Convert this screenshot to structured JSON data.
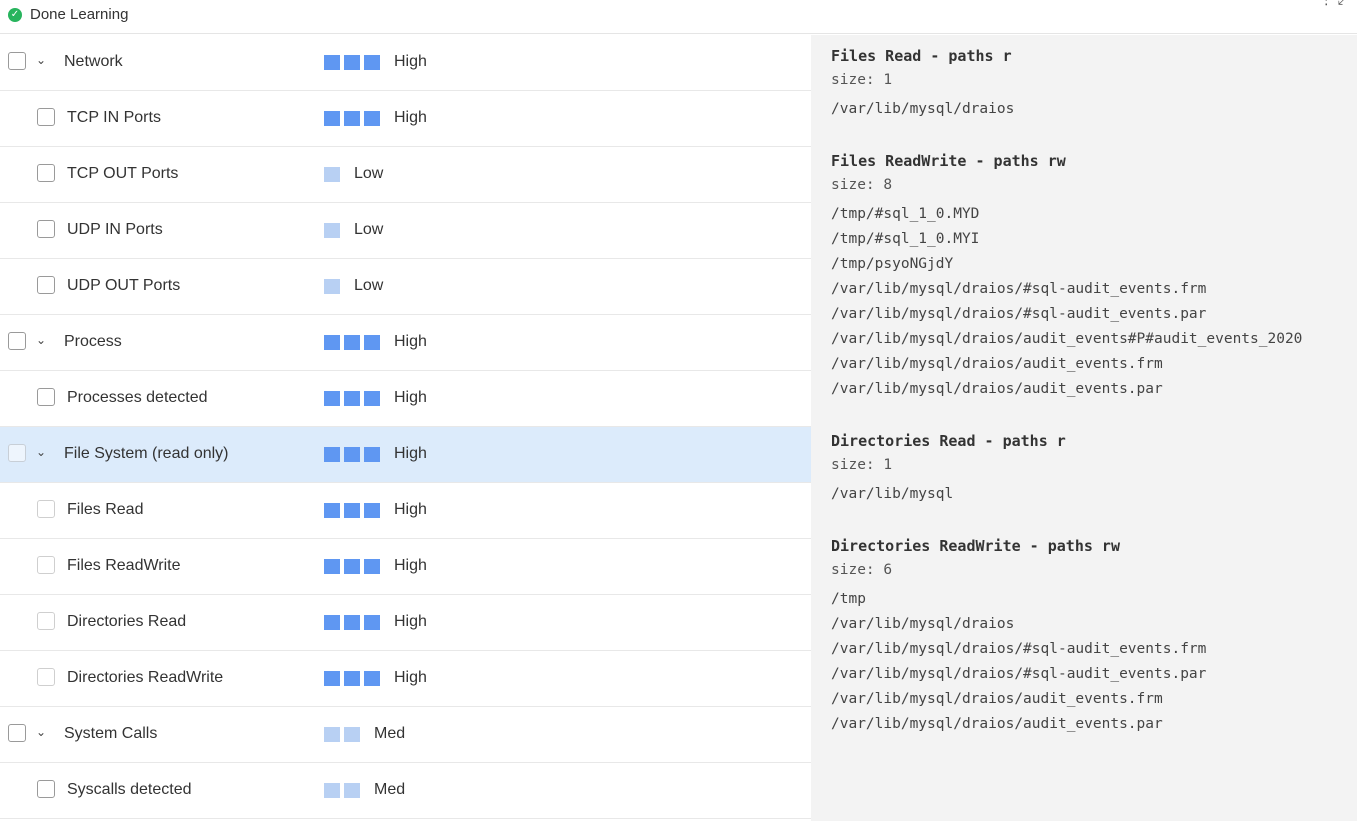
{
  "status": {
    "text": "Done Learning",
    "color": "#27b45d"
  },
  "rows": [
    {
      "label": "Network",
      "level": "High",
      "bars": 3,
      "kind": "parent",
      "selected": false
    },
    {
      "label": "TCP IN Ports",
      "level": "High",
      "bars": 3,
      "kind": "child",
      "selected": false
    },
    {
      "label": "TCP OUT Ports",
      "level": "Low",
      "bars": 1,
      "kind": "child",
      "selected": false
    },
    {
      "label": "UDP IN Ports",
      "level": "Low",
      "bars": 1,
      "kind": "child",
      "selected": false
    },
    {
      "label": "UDP OUT Ports",
      "level": "Low",
      "bars": 1,
      "kind": "child",
      "selected": false
    },
    {
      "label": "Process",
      "level": "High",
      "bars": 3,
      "kind": "parent",
      "selected": false
    },
    {
      "label": "Processes detected",
      "level": "High",
      "bars": 3,
      "kind": "child",
      "selected": false
    },
    {
      "label": "File System (read only)",
      "level": "High",
      "bars": 3,
      "kind": "parent",
      "selected": true
    },
    {
      "label": "Files Read",
      "level": "High",
      "bars": 3,
      "kind": "child",
      "selected": false
    },
    {
      "label": "Files ReadWrite",
      "level": "High",
      "bars": 3,
      "kind": "child",
      "selected": false
    },
    {
      "label": "Directories Read",
      "level": "High",
      "bars": 3,
      "kind": "child",
      "selected": false
    },
    {
      "label": "Directories ReadWrite",
      "level": "High",
      "bars": 3,
      "kind": "child",
      "selected": false
    },
    {
      "label": "System Calls",
      "level": "Med",
      "bars": 2,
      "kind": "parent",
      "selected": false
    },
    {
      "label": "Syscalls detected",
      "level": "Med",
      "bars": 2,
      "kind": "child",
      "selected": false
    }
  ],
  "details": {
    "groups": [
      {
        "title": "Files Read - paths r",
        "size": "size: 1",
        "paths": [
          "/var/lib/mysql/draios"
        ]
      },
      {
        "title": "Files ReadWrite - paths rw",
        "size": "size: 8",
        "paths": [
          "/tmp/#sql_1_0.MYD",
          "/tmp/#sql_1_0.MYI",
          "/tmp/psyoNGjdY",
          "/var/lib/mysql/draios/#sql-audit_events.frm",
          "/var/lib/mysql/draios/#sql-audit_events.par",
          "/var/lib/mysql/draios/audit_events#P#audit_events_2020",
          "/var/lib/mysql/draios/audit_events.frm",
          "/var/lib/mysql/draios/audit_events.par"
        ]
      },
      {
        "title": "Directories Read - paths r",
        "size": "size: 1",
        "paths": [
          "/var/lib/mysql"
        ]
      },
      {
        "title": "Directories ReadWrite - paths rw",
        "size": "size: 6",
        "paths": [
          "/tmp",
          "/var/lib/mysql/draios",
          "/var/lib/mysql/draios/#sql-audit_events.frm",
          "/var/lib/mysql/draios/#sql-audit_events.par",
          "/var/lib/mysql/draios/audit_events.frm",
          "/var/lib/mysql/draios/audit_events.par"
        ]
      }
    ]
  }
}
